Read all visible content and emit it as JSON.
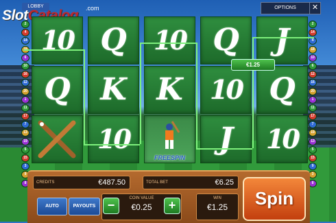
{
  "header": {
    "lobby_label": "LOBBY",
    "logo_slot": "Slot",
    "logo_catalog": "Catalog",
    "logo_com": ".com",
    "options_label": "OPTIONS",
    "close_symbol": "✕"
  },
  "paylines": {
    "left": [
      "2",
      "4",
      "14",
      "18",
      "6",
      "10",
      "16",
      "12",
      "20",
      "1",
      "11",
      "17",
      "7",
      "13",
      "19",
      "5",
      "15",
      "3",
      "9",
      "8"
    ],
    "right": [
      "2",
      "14",
      "4",
      "18",
      "10",
      "6",
      "12",
      "16",
      "20",
      "1",
      "11",
      "17",
      "7",
      "19",
      "13",
      "5",
      "15",
      "9",
      "3",
      "8"
    ]
  },
  "reels": [
    [
      "10",
      "Q",
      "bats"
    ],
    [
      "Q",
      "K",
      "10"
    ],
    [
      "10",
      "K",
      "freespin"
    ],
    [
      "Q",
      "10",
      "J"
    ],
    [
      "J",
      "Q",
      "10"
    ]
  ],
  "freespin_label": "FREESPIN",
  "line_win_badge": "€1.25",
  "panel": {
    "credits_label": "CREDITS",
    "credits_value": "€487.50",
    "total_bet_label": "TOTAL BET",
    "total_bet_value": "€6.25",
    "auto_label": "AUTO",
    "payouts_label": "PAYOUTS",
    "coin_value_label": "COIN VALUE",
    "coin_value": "€0.25",
    "minus_symbol": "−",
    "plus_symbol": "+",
    "win_label": "WIN",
    "win_value": "€1.25",
    "spin_label": "Spin"
  },
  "colors": {
    "reel_green": "#2f8e3f",
    "payline_green": "#7ef07c",
    "panel_brown": "#b46a2e",
    "spin_orange": "#e8642a",
    "button_blue": "#2b59a8"
  }
}
